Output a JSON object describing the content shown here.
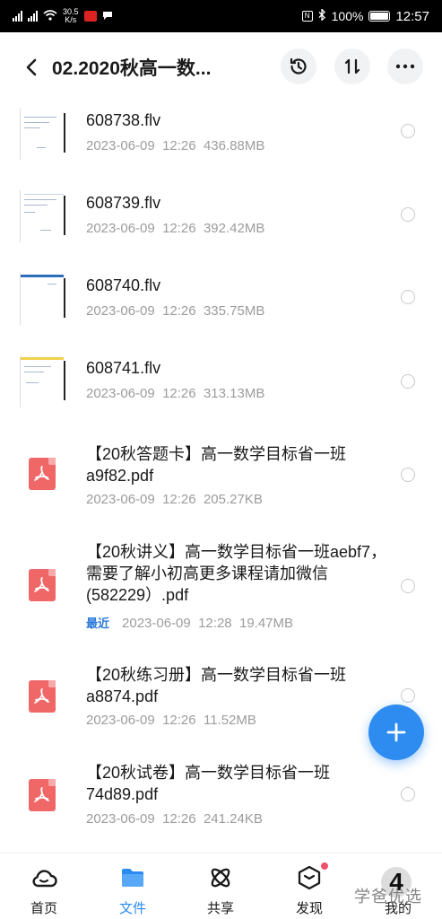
{
  "status_bar": {
    "speed_top": "30.5",
    "speed_bottom": "K/s",
    "battery": "100%",
    "time": "12:57"
  },
  "header": {
    "title": "02.2020秋高一数...",
    "back_icon": "chevron-left-icon",
    "history_icon": "history-icon",
    "sort_icon": "sort-icon",
    "more_icon": "more-icon"
  },
  "files": [
    {
      "name": "608738.flv",
      "date": "2023-06-09",
      "time": "12:26",
      "size": "436.88MB"
    },
    {
      "name": "608739.flv",
      "date": "2023-06-09",
      "time": "12:26",
      "size": "392.42MB"
    },
    {
      "name": "608740.flv",
      "date": "2023-06-09",
      "time": "12:26",
      "size": "335.75MB"
    },
    {
      "name": "608741.flv",
      "date": "2023-06-09",
      "time": "12:26",
      "size": "313.13MB"
    },
    {
      "name": "【20秋答题卡】高一数学目标省一班a9f82.pdf",
      "date": "2023-06-09",
      "time": "12:26",
      "size": "205.27KB"
    },
    {
      "name": "【20秋讲义】高一数学目标省一班aebf7，需要了解小初高更多课程请加微信(582229）.pdf",
      "tag": "最近",
      "date": "2023-06-09",
      "time": "12:28",
      "size": "19.47MB"
    },
    {
      "name": "【20秋练习册】高一数学目标省一班a8874.pdf",
      "date": "2023-06-09",
      "time": "12:26",
      "size": "11.52MB"
    },
    {
      "name": "【20秋试卷】高一数学目标省一班74d89.pdf",
      "date": "2023-06-09",
      "time": "12:26",
      "size": "241.24KB"
    }
  ],
  "bottom_nav": [
    {
      "label": "首页",
      "icon": "home-cloud-icon"
    },
    {
      "label": "文件",
      "icon": "folder-icon",
      "active": true
    },
    {
      "label": "共享",
      "icon": "share-atom-icon"
    },
    {
      "label": "发现",
      "icon": "discover-box-icon"
    },
    {
      "label": "我的",
      "icon": "profile-icon"
    }
  ],
  "watermark": {
    "text": "学爸优选",
    "badge": "4"
  },
  "colors": {
    "accent": "#2a8af0",
    "pdf": "#f06767",
    "meta": "#9c9c9c",
    "recent": "#2a79d8"
  }
}
